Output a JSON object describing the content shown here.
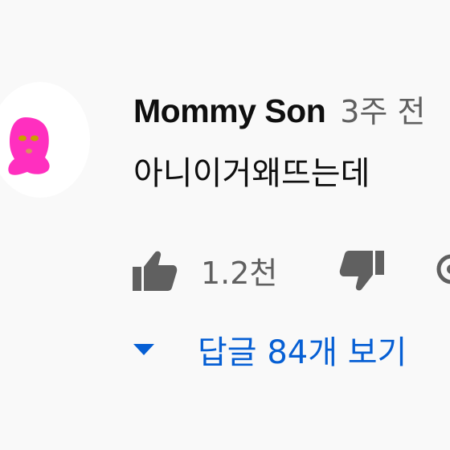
{
  "comment": {
    "author": "Mommy Son",
    "timestamp": "3주 전",
    "text": "아니이거왜뜨는데",
    "like_count": "1.2천",
    "replies_label": "답글 84개 보기"
  },
  "icons": {
    "avatar": "pink-balaclava-avatar",
    "like": "thumbs-up-icon",
    "dislike": "thumbs-down-icon",
    "reply": "reply-icon",
    "replies_toggle": "caret-down-icon"
  },
  "colors": {
    "background": "#f9f9f9",
    "text_primary": "#0f0f0f",
    "text_secondary": "#606060",
    "link_blue": "#065fd4",
    "avatar_pink": "#ff2fbf"
  }
}
